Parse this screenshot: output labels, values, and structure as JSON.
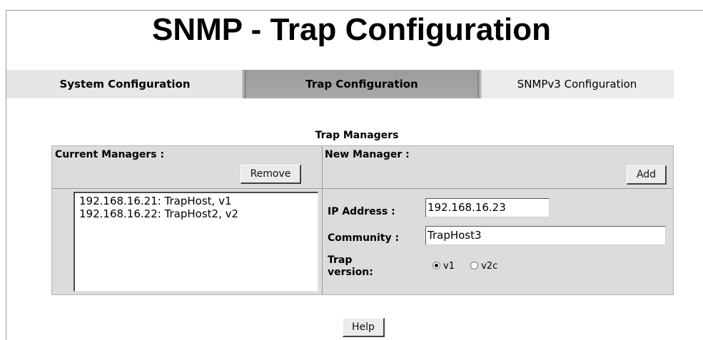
{
  "page_title": "SNMP - Trap Configuration",
  "tabs": [
    {
      "label": "System Configuration",
      "active": false
    },
    {
      "label": "Trap Configuration",
      "active": true
    },
    {
      "label": "SNMPv3 Configuration",
      "active": false
    }
  ],
  "trap_managers": {
    "title": "Trap Managers",
    "current_label": "Current Managers :",
    "remove_label": "Remove",
    "managers": [
      "192.168.16.21: TrapHost, v1",
      "192.168.16.22: TrapHost2, v2"
    ],
    "new_label": "New Manager :",
    "add_label": "Add",
    "ip_label": "IP Address :",
    "ip_value": "192.168.16.23",
    "community_label": "Community :",
    "community_value": "TrapHost3",
    "version_label": "Trap version:",
    "version_options": [
      "v1",
      "v2c"
    ],
    "version_selected": "v1"
  },
  "help_label": "Help"
}
